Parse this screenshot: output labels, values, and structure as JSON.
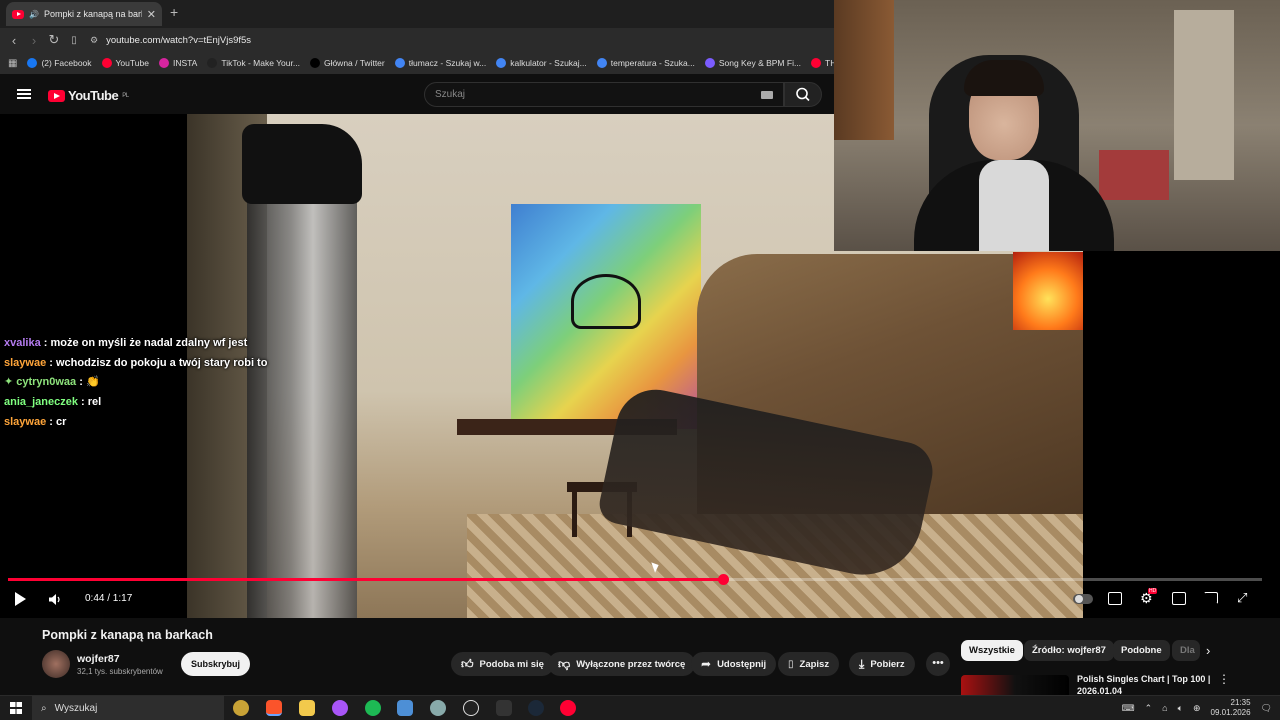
{
  "browser": {
    "tab_title": "Pompki z kanapą na barkach",
    "new_tab": "+",
    "url": "youtube.com/watch?v=tEnjVjs9f5s",
    "bookmarks": [
      {
        "label": "(2) Facebook",
        "color": "#1877f2"
      },
      {
        "label": "YouTube",
        "color": "#ff0033"
      },
      {
        "label": "INSTA",
        "color": "#d6249f"
      },
      {
        "label": "TikTok - Make Your...",
        "color": "#222222"
      },
      {
        "label": "Główna / Twitter",
        "color": "#000000"
      },
      {
        "label": "tłumacz - Szukaj w...",
        "color": "#4285f4"
      },
      {
        "label": "kalkulator - Szukaj...",
        "color": "#4285f4"
      },
      {
        "label": "temperatura - Szuka...",
        "color": "#4285f4"
      },
      {
        "label": "Song Key & BPM Fi...",
        "color": "#7b5cff"
      },
      {
        "label": "TH",
        "color": "#ff0033"
      }
    ]
  },
  "youtube": {
    "logo_text": "YouTube",
    "logo_region": "PL",
    "search_placeholder": "Szukaj"
  },
  "chat": [
    {
      "user": "xvalika",
      "message": "może on myśli że nadal zdalny wf jest",
      "cls": "cu1"
    },
    {
      "user": "slaywae",
      "message": "wchodzisz do pokoju a twój stary robi to",
      "cls": "cu2"
    },
    {
      "user": "cytryn0waa",
      "message": "👏",
      "cls": "cu3",
      "badge": "✦"
    },
    {
      "user": "ania_janeczek",
      "message": "rel",
      "cls": "cu4"
    },
    {
      "user": "slaywae",
      "message": "cr",
      "cls": "cu2"
    }
  ],
  "player": {
    "time": "0:44 / 1:17",
    "progress": 0.57
  },
  "video": {
    "title": "Pompki z kanapą na barkach",
    "channel": "wojfer87",
    "subscribers": "32,1 tys. subskrybentów",
    "subscribe_label": "Subskrybuj",
    "actions": {
      "like": "Podoba mi się",
      "dislike": "Wyłączone przez twórcę",
      "share": "Udostępnij",
      "save": "Zapisz",
      "download": "Pobierz"
    }
  },
  "chips": [
    "Wszystkie",
    "Źródło: wojfer87",
    "Podobne",
    "Dla"
  ],
  "recommended": {
    "title": "Polish Singles Chart | Top 100 | 2026.01.04"
  },
  "taskbar": {
    "search_label": "Wyszukaj",
    "time": "21:35",
    "date": "09.01.2026"
  }
}
